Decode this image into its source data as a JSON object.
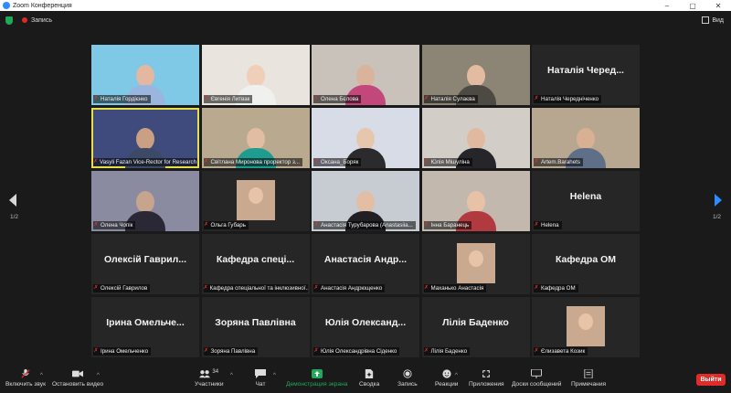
{
  "window": {
    "title": "Zoom Конференция",
    "minimize": "–",
    "maximize": "▢",
    "close": "✕"
  },
  "topbar": {
    "record_label": "Запись",
    "view_label": "Вид"
  },
  "pagination": {
    "left": "1/2",
    "right": "1/2"
  },
  "tiles": [
    {
      "label": "Наталія Гордієнко",
      "big": "",
      "type": "video",
      "bg": "#7fc9e6",
      "face": "#e4b8a0",
      "cloth": "#9ab6de",
      "muted": true
    },
    {
      "label": "Євгенія Литвак",
      "big": "",
      "type": "video",
      "bg": "#e9e4dd",
      "face": "#efcfb8",
      "cloth": "#f0f0ee",
      "muted": true
    },
    {
      "label": "Олена Бєлова",
      "big": "",
      "type": "video",
      "bg": "#c8c2bb",
      "face": "#d9b39c",
      "cloth": "#c2477a",
      "muted": true
    },
    {
      "label": "Наталія Сулаєва",
      "big": "",
      "type": "video",
      "bg": "#8c8576",
      "face": "#e2bba1",
      "cloth": "#4d4a44",
      "muted": true
    },
    {
      "label": "Наталія Чередніченко",
      "big": "Наталія Черед...",
      "type": "name",
      "muted": true
    },
    {
      "label": "Vasyli Fazan Vice-Rector for Research",
      "big": "",
      "type": "video",
      "bg": "#3f4a7d",
      "face": "#c9a084",
      "cloth": "#3c4a66",
      "muted": true,
      "active": true
    },
    {
      "label": "Світлана Миронова проректор з...",
      "big": "",
      "type": "video",
      "bg": "#b9a98e",
      "face": "#e1bda3",
      "cloth": "#1e9c8f",
      "muted": true
    },
    {
      "label": "Оксана_Боряк",
      "big": "",
      "type": "video",
      "bg": "#d7dce6",
      "face": "#e6c6ad",
      "cloth": "#2b2b2e",
      "muted": true
    },
    {
      "label": "Юлія Мішуліна",
      "big": "",
      "type": "video",
      "bg": "#d3cdc8",
      "face": "#e1b99f",
      "cloth": "#26262a",
      "muted": true
    },
    {
      "label": "Artem.Barahets",
      "big": "",
      "type": "video",
      "bg": "#b7a690",
      "face": "#d8b195",
      "cloth": "#5f6f88",
      "muted": true
    },
    {
      "label": "Олена Чопік",
      "big": "",
      "type": "video",
      "bg": "#8a8aa0",
      "face": "#c6a48d",
      "cloth": "#2b2836",
      "muted": true
    },
    {
      "label": "Ольга Губарь",
      "big": "",
      "type": "thumb",
      "muted": true
    },
    {
      "label": "Анастасія Турубарова (Anastasiia...",
      "big": "",
      "type": "video",
      "bg": "#c6ccd2",
      "face": "#e2bea5",
      "cloth": "#1f1f24",
      "muted": true
    },
    {
      "label": "Інна Баранець",
      "big": "",
      "type": "video",
      "bg": "#c2b8ae",
      "face": "#e7c2a6",
      "cloth": "#b03a40",
      "muted": true
    },
    {
      "label": "Helena",
      "big": "Helena",
      "type": "name",
      "muted": true
    },
    {
      "label": "Олексій Гаврилов",
      "big": "Олексій Гаврил...",
      "type": "name",
      "muted": true
    },
    {
      "label": "Кафедра спеціальної та інклюзивної...",
      "big": "Кафедра спеці...",
      "type": "name",
      "muted": true
    },
    {
      "label": "Анастасія Андрющенко",
      "big": "Анастасія Андр...",
      "type": "name",
      "muted": true
    },
    {
      "label": "Маханько Анастасія",
      "big": "",
      "type": "thumb",
      "muted": true
    },
    {
      "label": "Кафедра ОМ",
      "big": "Кафедра ОМ",
      "type": "name",
      "muted": true
    },
    {
      "label": "Ірина Омельченко",
      "big": "Ірина Омельче...",
      "type": "name",
      "muted": true
    },
    {
      "label": "Зоряна Павлівна",
      "big": "Зоряна Павлівна",
      "type": "name",
      "muted": true
    },
    {
      "label": "Юлія Олександрівна Сіденко",
      "big": "Юлія Олександ...",
      "type": "name",
      "muted": true
    },
    {
      "label": "Лілія Баденко",
      "big": "Лілія Баденко",
      "type": "name",
      "muted": true
    },
    {
      "label": "Єлизавета Козик",
      "big": "",
      "type": "thumb",
      "muted": true
    }
  ],
  "toolbar": {
    "unmute": "Включить звук",
    "video": "Остановить видео",
    "participants": "Участники",
    "participants_count": "34",
    "chat": "Чат",
    "share": "Демонстрация экрана",
    "summary": "Сводка",
    "record": "Запись",
    "reactions": "Реакции",
    "apps": "Приложения",
    "whiteboard": "Доски сообщений",
    "notes": "Примечания",
    "leave": "Выйти"
  },
  "colors": {
    "accent_green": "#21a95a",
    "leave_red": "#e02b28",
    "active_speaker": "#e5e04a",
    "muted_red": "#e3322d"
  }
}
